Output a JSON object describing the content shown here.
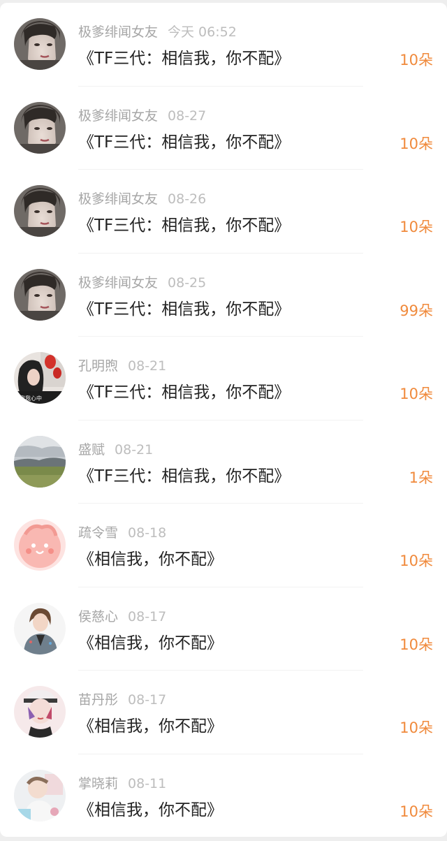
{
  "rows": [
    {
      "name": "极爹绯闻女友",
      "date": "今天 06:52",
      "title": "《TF三代：相信我，你不配》",
      "count": "10朵",
      "avatar": "male-portrait"
    },
    {
      "name": "极爹绯闻女友",
      "date": "08-27",
      "title": "《TF三代：相信我，你不配》",
      "count": "10朵",
      "avatar": "male-portrait"
    },
    {
      "name": "极爹绯闻女友",
      "date": "08-26",
      "title": "《TF三代：相信我，你不配》",
      "count": "10朵",
      "avatar": "male-portrait"
    },
    {
      "name": "极爹绯闻女友",
      "date": "08-25",
      "title": "《TF三代：相信我，你不配》",
      "count": "99朵",
      "avatar": "male-portrait"
    },
    {
      "name": "孔明煦",
      "date": "08-21",
      "title": "《TF三代：相信我，你不配》",
      "count": "10朵",
      "avatar": "girl-with-lantern"
    },
    {
      "name": "盛赋",
      "date": "08-21",
      "title": "《TF三代：相信我，你不配》",
      "count": "1朵",
      "avatar": "grassland-landscape"
    },
    {
      "name": "疏令雪",
      "date": "08-18",
      "title": "《相信我，你不配》",
      "count": "10朵",
      "avatar": "pink-cartoon"
    },
    {
      "name": "侯慈心",
      "date": "08-17",
      "title": "《相信我，你不配》",
      "count": "10朵",
      "avatar": "anime-girl-jacket"
    },
    {
      "name": "苗丹彤",
      "date": "08-17",
      "title": "《相信我，你不配》",
      "count": "10朵",
      "avatar": "anime-boy-headband"
    },
    {
      "name": "掌晓莉",
      "date": "08-11",
      "title": "《相信我，你不配》",
      "count": "10朵",
      "avatar": "baby-photo"
    }
  ],
  "colors": {
    "name": "#a6a6a6",
    "date": "#bdbdbd",
    "title": "#222222",
    "count": "#f08a3c"
  }
}
